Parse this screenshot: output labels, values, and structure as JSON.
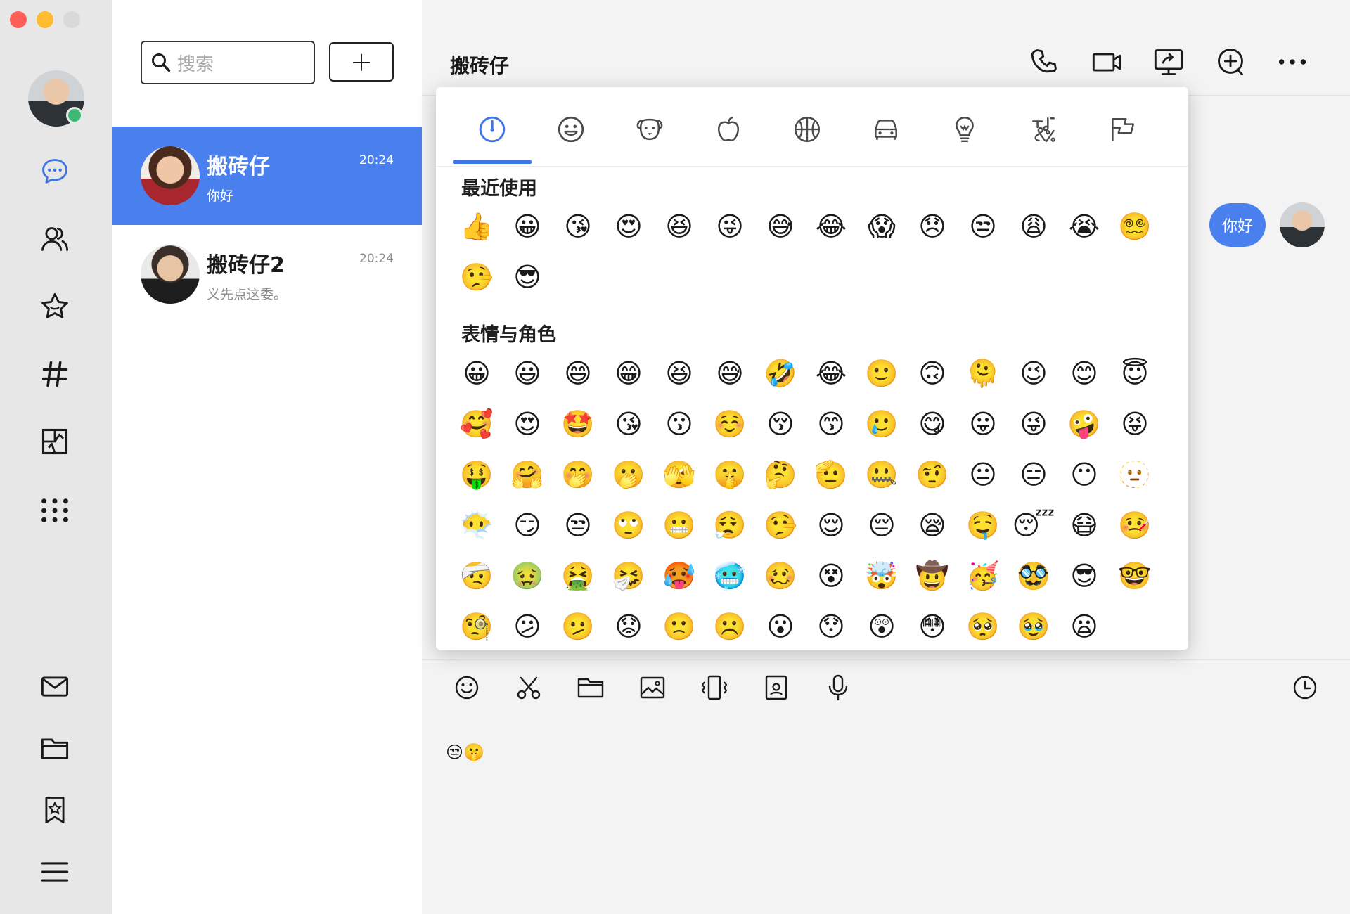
{
  "window": {
    "title": ""
  },
  "search": {
    "placeholder": "搜索",
    "add_label": "+"
  },
  "conversations": [
    {
      "name": "搬砖仔",
      "time": "20:24",
      "preview": "你好",
      "active": true
    },
    {
      "name": "搬砖仔2",
      "time": "20:24",
      "preview": "义先点这委。",
      "active": false
    }
  ],
  "chat": {
    "title": "搬砖仔",
    "message": "你好",
    "draft": "😒🤫"
  },
  "emoji_picker": {
    "categories": [
      "recent-icon",
      "smiley-icon",
      "animal-icon",
      "food-icon",
      "sport-icon",
      "travel-icon",
      "object-icon",
      "symbol-icon",
      "flag-icon"
    ],
    "selected_category": "recent-icon",
    "recent_title": "最近使用",
    "recent": "👍😀😘😍😆😜😅😂😱😞😒😩😭😵‍💫🤥😎",
    "faces_title": "表情与角色",
    "faces": "😀😃😄😁😆😅🤣😂🙂🙃🫠😉😊😇🥰😍🤩😘😗☺️😚😙🥲😋😛😜🤪😝🤑🤗🤭🫢🫣🤫🤔🫡🤐🤨😐😑😶🫥😶‍🌫️😏😒🙄😬😮‍💨🤥😌😔😪🤤😴😷🤒🤕🤢🤮🤧🥵🥶🥴😵🤯🤠🥳🥸😎🤓🧐😕🫤😟🙁☹️😮😯😲😳🥺🥹😦"
  },
  "colors": {
    "accent": "#4a7fee",
    "online": "#3dbb74"
  }
}
